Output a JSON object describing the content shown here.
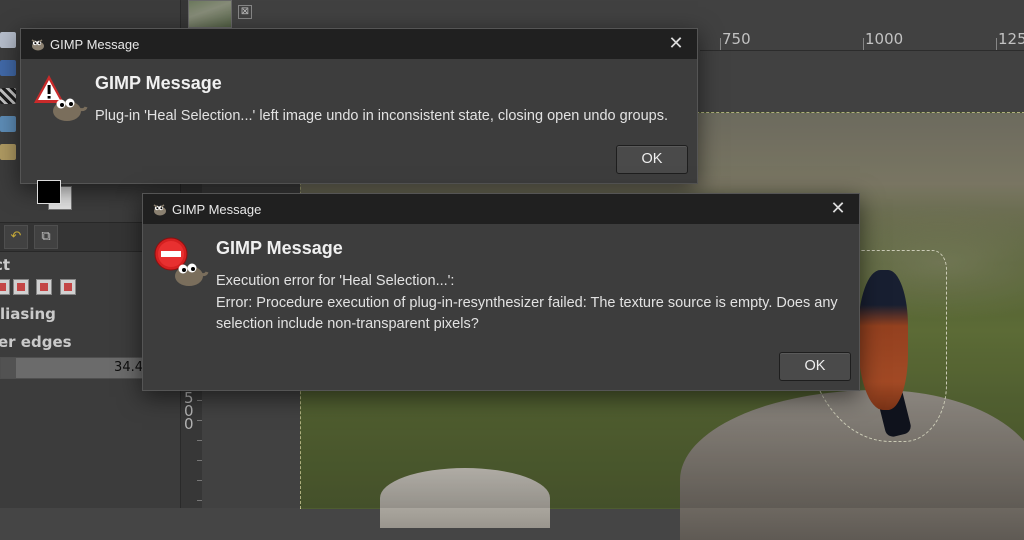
{
  "workspace": {
    "tool_options": {
      "text_fragment_1": "ct",
      "antialiasing_fragment": "liasing",
      "feather_fragment": "er edges",
      "slider_value": "34.4"
    },
    "vertical_ruler_labels": [
      "5",
      "0",
      "0"
    ],
    "horizontal_ruler_labels": [
      "750",
      "1000",
      "125"
    ],
    "tab_close_glyph": "⊠"
  },
  "dialog_warning": {
    "window_title": "GIMP Message",
    "heading": "GIMP Message",
    "message": "Plug-in 'Heal Selection...' left image undo in inconsistent state, closing open undo groups.",
    "ok_label": "OK",
    "close_glyph": "✕",
    "icon": "warning-icon"
  },
  "dialog_error": {
    "window_title": "GIMP Message",
    "heading": "GIMP Message",
    "message_line1": "Execution error for 'Heal Selection...':",
    "message_line2": "Error: Procedure execution of plug-in-resynthesizer failed: The texture source is empty. Does any",
    "message_line3": "selection include non-transparent pixels?",
    "ok_label": "OK",
    "close_glyph": "✕",
    "icon": "error-icon"
  }
}
